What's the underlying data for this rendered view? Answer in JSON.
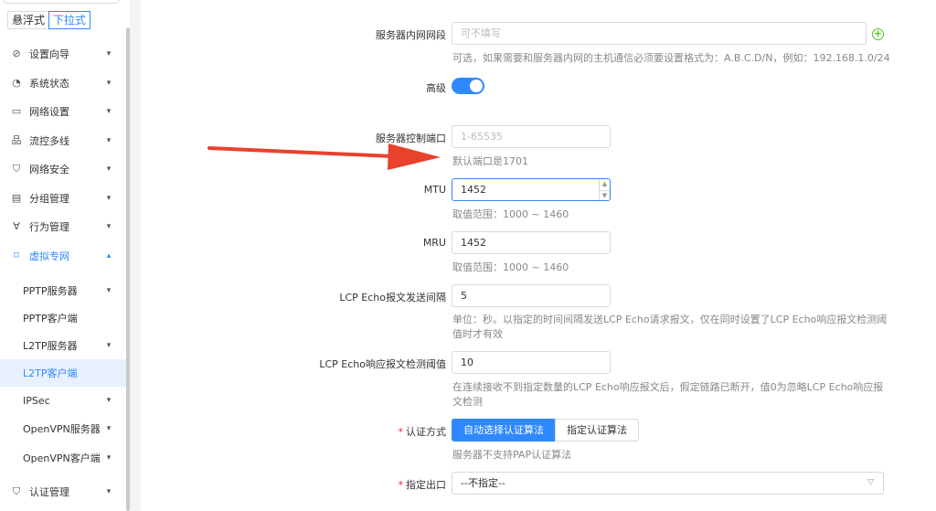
{
  "sidebar": {
    "modes": [
      "悬浮式",
      "下拉式"
    ],
    "items": [
      {
        "label": "设置向导",
        "icon": "compass-icon"
      },
      {
        "label": "系统状态",
        "icon": "dashboard-icon"
      },
      {
        "label": "网络设置",
        "icon": "monitor-icon"
      },
      {
        "label": "流控多线",
        "icon": "network-icon"
      },
      {
        "label": "网络安全",
        "icon": "shield-icon"
      },
      {
        "label": "分组管理",
        "icon": "document-icon"
      },
      {
        "label": "行为管理",
        "icon": "filter-icon"
      },
      {
        "label": "虚拟专网",
        "icon": "vpn-icon"
      }
    ],
    "subitems": [
      "PPTP服务器",
      "PPTP客户端",
      "L2TP服务器",
      "L2TP客户端",
      "IPSec",
      "OpenVPN服务器",
      "OpenVPN客户端"
    ],
    "bottom_item": {
      "label": "认证管理",
      "icon": "shield-check-icon"
    }
  },
  "form": {
    "subnet": {
      "label": "服务器内网网段",
      "placeholder": "可不填写",
      "hint": "可选，如果需要和服务器内网的主机通信必须要设置格式为：A.B.C.D/N，例如：192.168.1.0/24"
    },
    "advanced": {
      "label": "高级"
    },
    "port": {
      "label": "服务器控制端口",
      "placeholder": "1-65535",
      "hint": "默认端口是1701"
    },
    "mtu": {
      "label": "MTU",
      "value": "1452",
      "hint": "取值范围：1000 ~ 1460"
    },
    "mru": {
      "label": "MRU",
      "value": "1452",
      "hint": "取值范围：1000 ~ 1460"
    },
    "lcp_interval": {
      "label": "LCP Echo报文发送间隔",
      "value": "5",
      "hint1": "单位：秒。以指定的时间间隔发送LCP Echo请求报文，仅在同时设置了LCP Echo响应报文检测阈",
      "hint2": "值时才有效"
    },
    "lcp_threshold": {
      "label": "LCP Echo响应报文检测阈值",
      "value": "10",
      "hint1": "在连续接收不到指定数量的LCP Echo响应报文后，假定链路已断开，值0为忽略LCP Echo响应报",
      "hint2": "文检测"
    },
    "auth": {
      "required_mark": "*",
      "label": "认证方式",
      "option_auto": "自动选择认证算法",
      "option_manual": "指定认证算法",
      "hint": "服务器不支持PAP认证算法"
    },
    "exit": {
      "required_mark": "*",
      "label": "指定出口",
      "value": "--不指定--"
    }
  },
  "colors": {
    "accent": "#2f88ff",
    "arrow": "#e8412c",
    "plus": "#52c41a"
  }
}
